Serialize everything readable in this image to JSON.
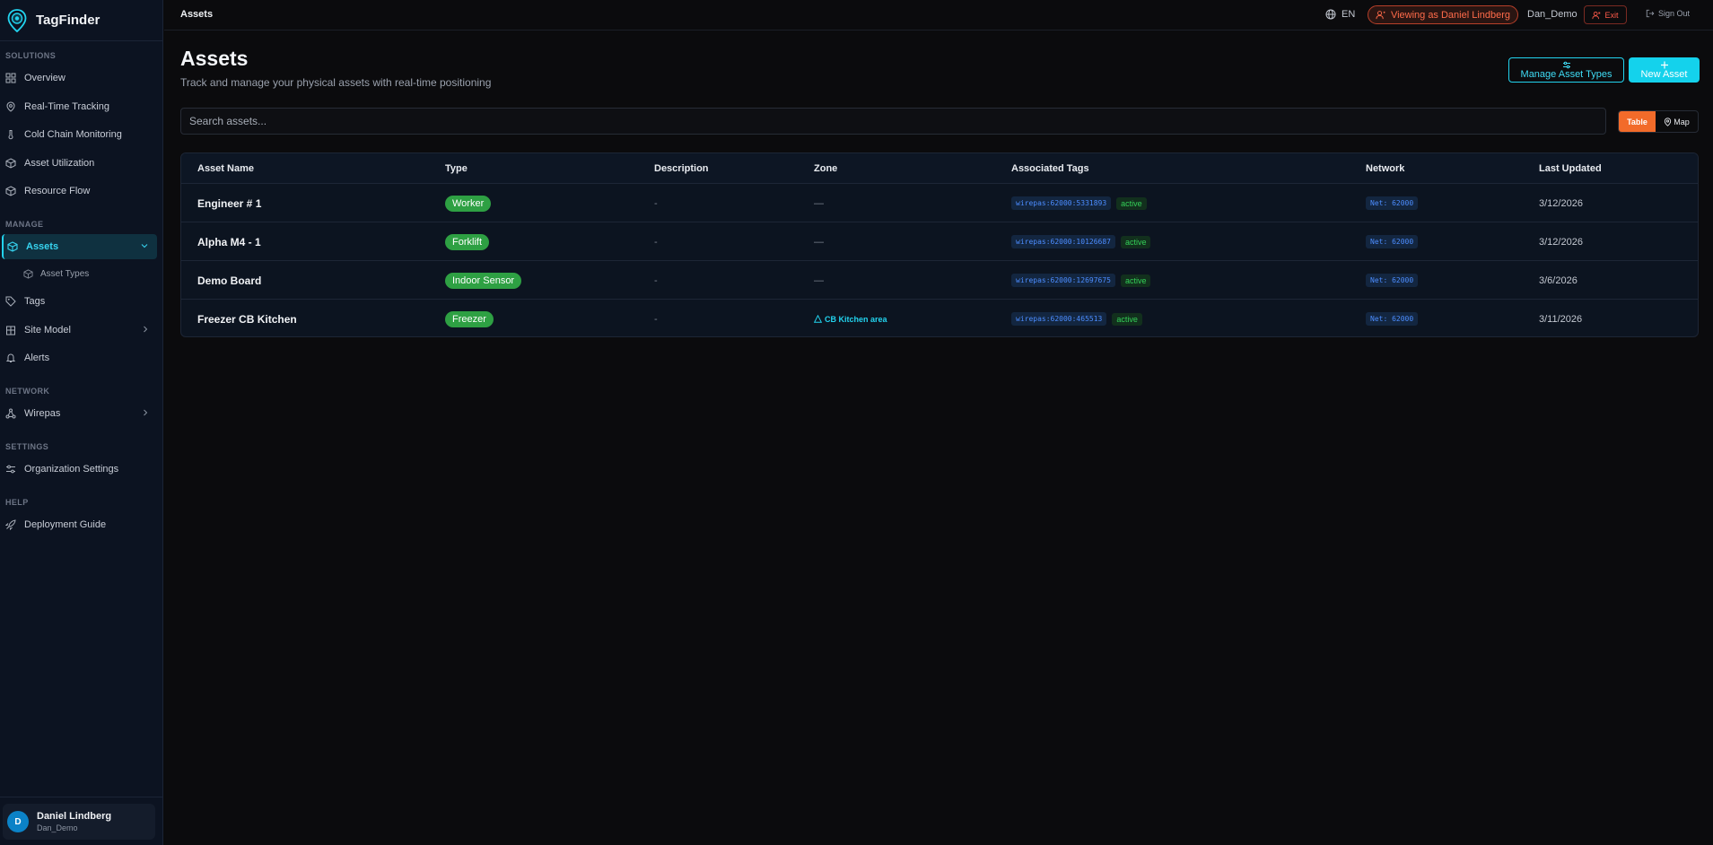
{
  "app": {
    "name": "TagFinder"
  },
  "sidebar": {
    "sections": {
      "solutions": "SOLUTIONS",
      "manage": "MANAGE",
      "network": "NETWORK",
      "settings": "SETTINGS",
      "help": "HELP"
    },
    "items": {
      "overview": "Overview",
      "realtime": "Real-Time Tracking",
      "coldchain": "Cold Chain Monitoring",
      "utilization": "Asset Utilization",
      "resourceflow": "Resource Flow",
      "assets": "Assets",
      "assettypes": "Asset Types",
      "tags": "Tags",
      "sitemodel": "Site Model",
      "alerts": "Alerts",
      "wirepas": "Wirepas",
      "orgsettings": "Organization Settings",
      "deployguide": "Deployment Guide"
    },
    "user": {
      "initial": "D",
      "name": "Daniel Lindberg",
      "handle": "Dan_Demo"
    }
  },
  "topbar": {
    "breadcrumb": "Assets",
    "language": "EN",
    "viewing_as": "Viewing as Daniel Lindberg",
    "username": "Dan_Demo",
    "exit": "Exit",
    "sign_out": "Sign Out"
  },
  "main": {
    "title": "Assets",
    "subtitle": "Track and manage your physical assets with real-time positioning",
    "manage_types_label": "Manage Asset Types",
    "new_asset_label": "New Asset",
    "search_placeholder": "Search assets...",
    "view_table": "Table",
    "view_map": "Map"
  },
  "table": {
    "headers": {
      "name": "Asset Name",
      "type": "Type",
      "description": "Description",
      "zone": "Zone",
      "tags": "Associated Tags",
      "network": "Network",
      "updated": "Last Updated"
    },
    "rows": [
      {
        "name": "Engineer # 1",
        "type": "Worker",
        "description": "-",
        "zone": "—",
        "tag": "wirepas:62000:5331893",
        "tag_status": "active",
        "network": "Net: 62000",
        "updated": "3/12/2026"
      },
      {
        "name": "Alpha M4 - 1",
        "type": "Forklift",
        "description": "-",
        "zone": "—",
        "tag": "wirepas:62000:10126687",
        "tag_status": "active",
        "network": "Net: 62000",
        "updated": "3/12/2026"
      },
      {
        "name": "Demo Board",
        "type": "Indoor Sensor",
        "description": "-",
        "zone": "—",
        "tag": "wirepas:62000:12697675",
        "tag_status": "active",
        "network": "Net: 62000",
        "updated": "3/6/2026"
      },
      {
        "name": "Freezer CB Kitchen",
        "type": "Freezer",
        "description": "-",
        "zone": "CB Kitchen area",
        "tag": "wirepas:62000:465513",
        "tag_status": "active",
        "network": "Net: 62000",
        "updated": "3/11/2026"
      }
    ]
  },
  "colors": {
    "accent": "#22d3ee",
    "warning": "#f26b2a",
    "success": "#2ea043",
    "danger": "#ff5a4a"
  }
}
